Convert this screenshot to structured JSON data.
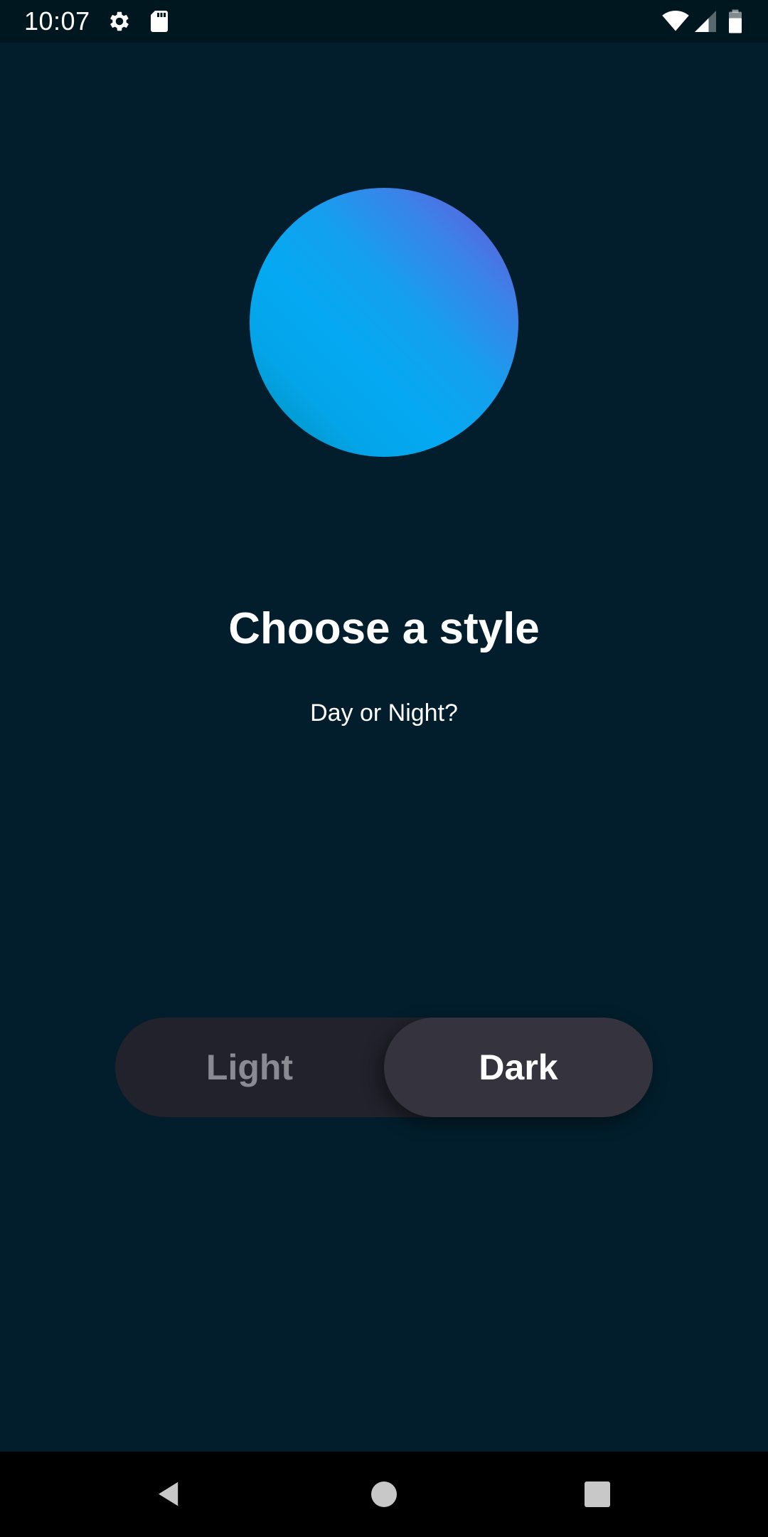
{
  "status_bar": {
    "time": "10:07",
    "icons": [
      "settings-icon",
      "sd-card-icon",
      "wifi-icon",
      "cell-signal-icon",
      "battery-icon"
    ]
  },
  "onboarding": {
    "title": "Choose a style",
    "subtitle": "Day or Night?"
  },
  "theme_toggle": {
    "options": [
      {
        "label": "Light",
        "selected": false
      },
      {
        "label": "Dark",
        "selected": true
      }
    ]
  },
  "nav_bar": {
    "buttons": [
      "back-icon",
      "home-icon",
      "recents-icon"
    ]
  },
  "colors": {
    "background": "#021e2c",
    "status_bar": "#011720",
    "toggle_track": "#21222b",
    "toggle_selected": "#35343e",
    "orb_gradient": [
      "#6a4fd6",
      "#04a9f2",
      "#008eb6"
    ]
  }
}
